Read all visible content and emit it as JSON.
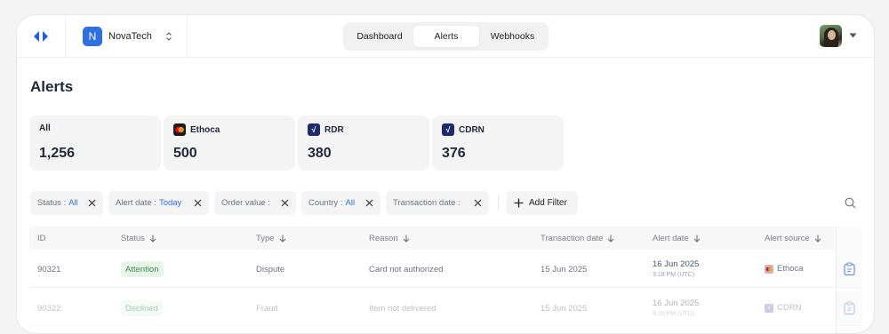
{
  "header": {
    "org": {
      "initial": "N",
      "name": "NovaTech"
    },
    "tabs": [
      {
        "label": "Dashboard",
        "active": false
      },
      {
        "label": "Alerts",
        "active": true
      },
      {
        "label": "Webhooks",
        "active": false
      }
    ]
  },
  "page": {
    "title": "Alerts"
  },
  "stats": [
    {
      "label": "All",
      "value": "1,256",
      "icon": "none"
    },
    {
      "label": "Ethoca",
      "value": "500",
      "icon": "mastercard-icon"
    },
    {
      "label": "RDR",
      "value": "380",
      "icon": "check-icon"
    },
    {
      "label": "CDRN",
      "value": "376",
      "icon": "check-icon"
    }
  ],
  "filters": [
    {
      "label": "Status :",
      "value": "All"
    },
    {
      "label": "Alert date :",
      "value": "Today"
    },
    {
      "label": "Order value :",
      "value": ""
    },
    {
      "label": "Country :",
      "value": "All"
    },
    {
      "label": "Transaction date :",
      "value": ""
    }
  ],
  "add_filter_label": "Add Filter",
  "table": {
    "columns": [
      "ID",
      "Status",
      "Type",
      "Reason",
      "Transaction date",
      "Alert date",
      "Alert source"
    ],
    "rows": [
      {
        "id": "90321",
        "status": "Attention",
        "type": "Dispute",
        "reason": "Card not authorized",
        "transaction_date": "15 Jun 2025",
        "alert_date": "16 Jun 2025",
        "alert_time": "3:18 PM (UTC)",
        "source": "Ethoca"
      },
      {
        "id": "90322",
        "status": "Declined",
        "type": "Fraud",
        "reason": "Item not delivered",
        "transaction_date": "15 Jun 2025",
        "alert_date": "16 Jun 2025",
        "alert_time": "4:20 PM (UTC)",
        "source": "CDRN"
      }
    ]
  },
  "colors": {
    "accent": "#2f6fe0",
    "badge_bg": "#e7f5ea",
    "badge_text": "#3f8a52",
    "check_icon_bg": "#1d2a6b"
  }
}
